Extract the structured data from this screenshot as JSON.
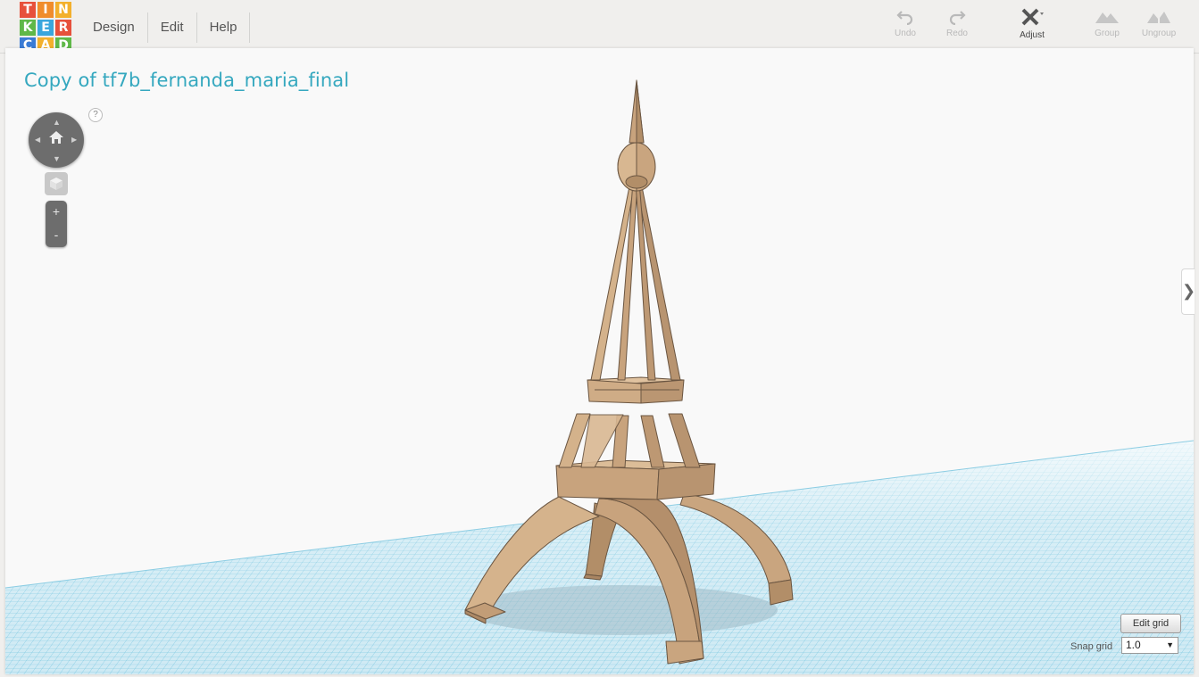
{
  "logo": {
    "letters": [
      "T",
      "I",
      "N",
      "K",
      "E",
      "R",
      "C",
      "A",
      "D"
    ],
    "colors": [
      "#e7503b",
      "#f08c2b",
      "#f3b02c",
      "#5fb848",
      "#3aa6dd",
      "#e7503b",
      "#3a7bd5",
      "#f3b02c",
      "#5fb848"
    ]
  },
  "menu": {
    "items": [
      "Design",
      "Edit",
      "Help"
    ]
  },
  "toolbar": {
    "undo": {
      "label": "Undo",
      "icon": "undo-icon"
    },
    "redo": {
      "label": "Redo",
      "icon": "redo-icon"
    },
    "adjust": {
      "label": "Adjust",
      "icon": "adjust-icon"
    },
    "group": {
      "label": "Group",
      "icon": "group-icon"
    },
    "ungroup": {
      "label": "Ungroup",
      "icon": "ungroup-icon"
    }
  },
  "design": {
    "title": "Copy of tf7b_fernanda_maria_final"
  },
  "view_controls": {
    "help": "?",
    "zoom_in": "+",
    "zoom_out": "-",
    "home_icon": "home-icon"
  },
  "grid_controls": {
    "edit_grid": "Edit grid",
    "snap_label": "Snap grid",
    "snap_value": "1.0"
  },
  "side_panel_toggle": "❯",
  "colors": {
    "accent": "#35a8bf",
    "model": "#c8a27c",
    "grid": "#6fc3df"
  }
}
